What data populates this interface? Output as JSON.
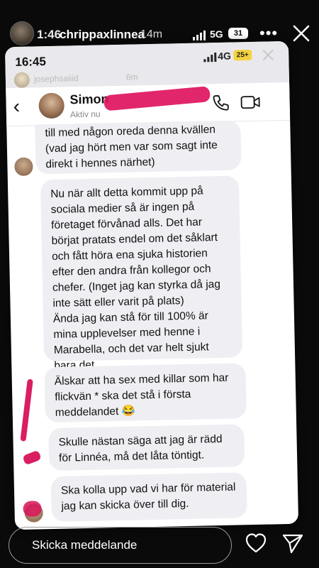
{
  "story": {
    "time": "1:46",
    "username": "chrippaxlinnea",
    "posted_ago": "14m",
    "network": "5G",
    "battery": "31"
  },
  "screenshot": {
    "status": {
      "time": "16:45",
      "network": "4G",
      "battery": "25+"
    },
    "poster": {
      "name": "josephsaiiid",
      "ago": "6m"
    },
    "contact": {
      "name": "Simon",
      "status": "Aktiv nu"
    },
    "messages": [
      "till med någon oreda denna kvällen (vad jag hört men var som sagt inte direkt i hennes närhet)",
      "Nu när allt detta kommit upp på sociala medier så är ingen på företaget förvånad alls. Det har börjat pratats endel om det såklart och fått höra ena sjuka historien efter den andra från kollegor och chefer. (Inget jag kan styrka då jag inte sätt eller varit på plats)\nÄnda jag kan stå för till 100% är mina upplevelser med henne i Marabella, och det var helt sjukt bara det.",
      "Älskar att ha sex med killar som har flickvän * ska det stå i första meddelandet 😂",
      "Skulle nästan säga att jag är rädd för Linnéa, må det låta töntigt.",
      "Ska kolla upp vad vi har för material jag kan skicka över till dig."
    ]
  },
  "reply": {
    "placeholder": "Skicka meddelande"
  },
  "icons": {
    "close": "close-icon",
    "more": "more-icon",
    "call": "phone-icon",
    "video": "video-icon",
    "heart": "heart-icon",
    "send": "send-icon"
  },
  "colors": {
    "redaction": "#e0135f",
    "bubble": "#efeff3",
    "background": "#0a0a0a"
  }
}
